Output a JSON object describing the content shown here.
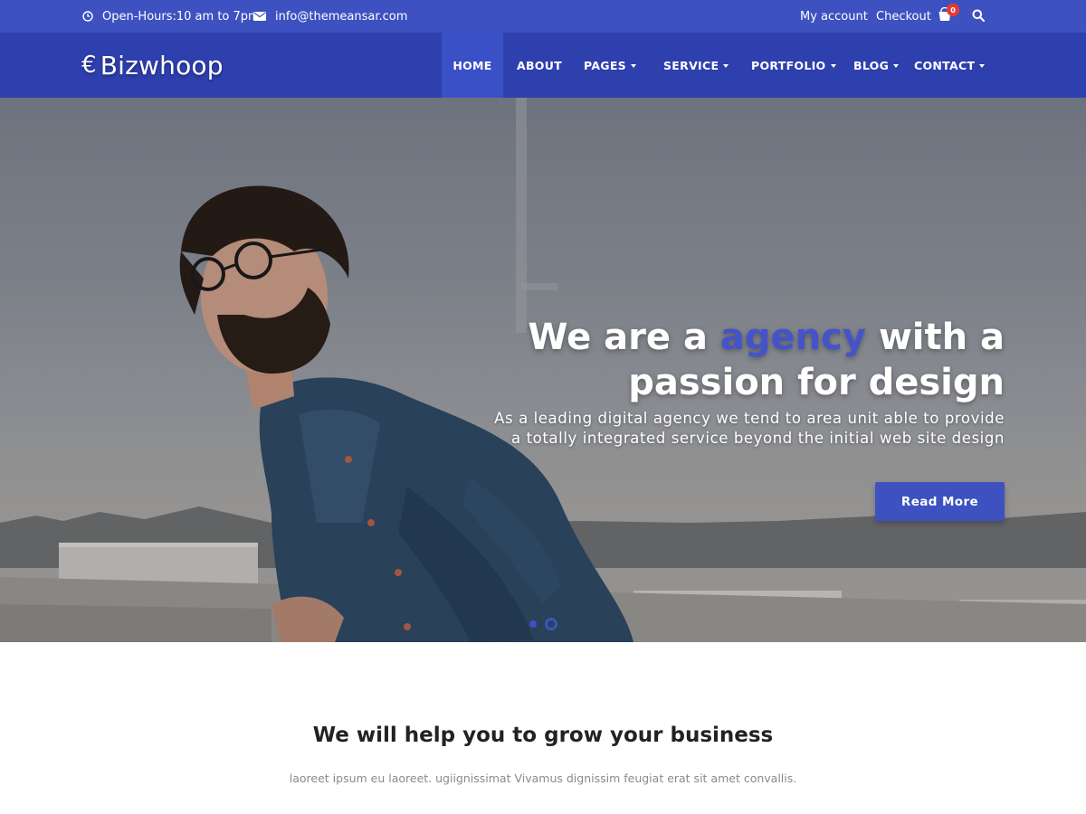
{
  "topbar": {
    "hours": "Open-Hours:10 am to 7pm",
    "email": "info@themeansar.com",
    "my_account": "My account",
    "checkout": "Checkout",
    "cart_count": "0",
    "icons": [
      "clock-icon",
      "envelope-icon",
      "cart-icon",
      "search-icon"
    ]
  },
  "header": {
    "logo_symbol": "€",
    "logo_text": "Bizwhoop",
    "nav": [
      {
        "label": "HOME"
      },
      {
        "label": "ABOUT"
      },
      {
        "label": "PAGES"
      },
      {
        "label": "SERVICE"
      },
      {
        "label": "PORTFOLIO"
      },
      {
        "label": "BLOG"
      },
      {
        "label": "CONTACT"
      }
    ]
  },
  "hero": {
    "title_part1": "We are a ",
    "title_highlight": "agency",
    "title_part2": " with a passion for design",
    "subtitle": "As a leading digital agency we tend to area unit able to provide a totally integrated service beyond the initial web site design",
    "button_label": "Read More",
    "slides_total": 2,
    "slide_active": 2
  },
  "section": {
    "title": "We will help you to grow your business",
    "text": "laoreet ipsum eu laoreet. ugiignissimat Vivamus dignissim feugiat erat sit amet convallis."
  },
  "colors": {
    "accent": "#3d52c0",
    "header_bg": "#2e3fae",
    "highlight": "#4553c9",
    "badge": "#e83a32"
  }
}
